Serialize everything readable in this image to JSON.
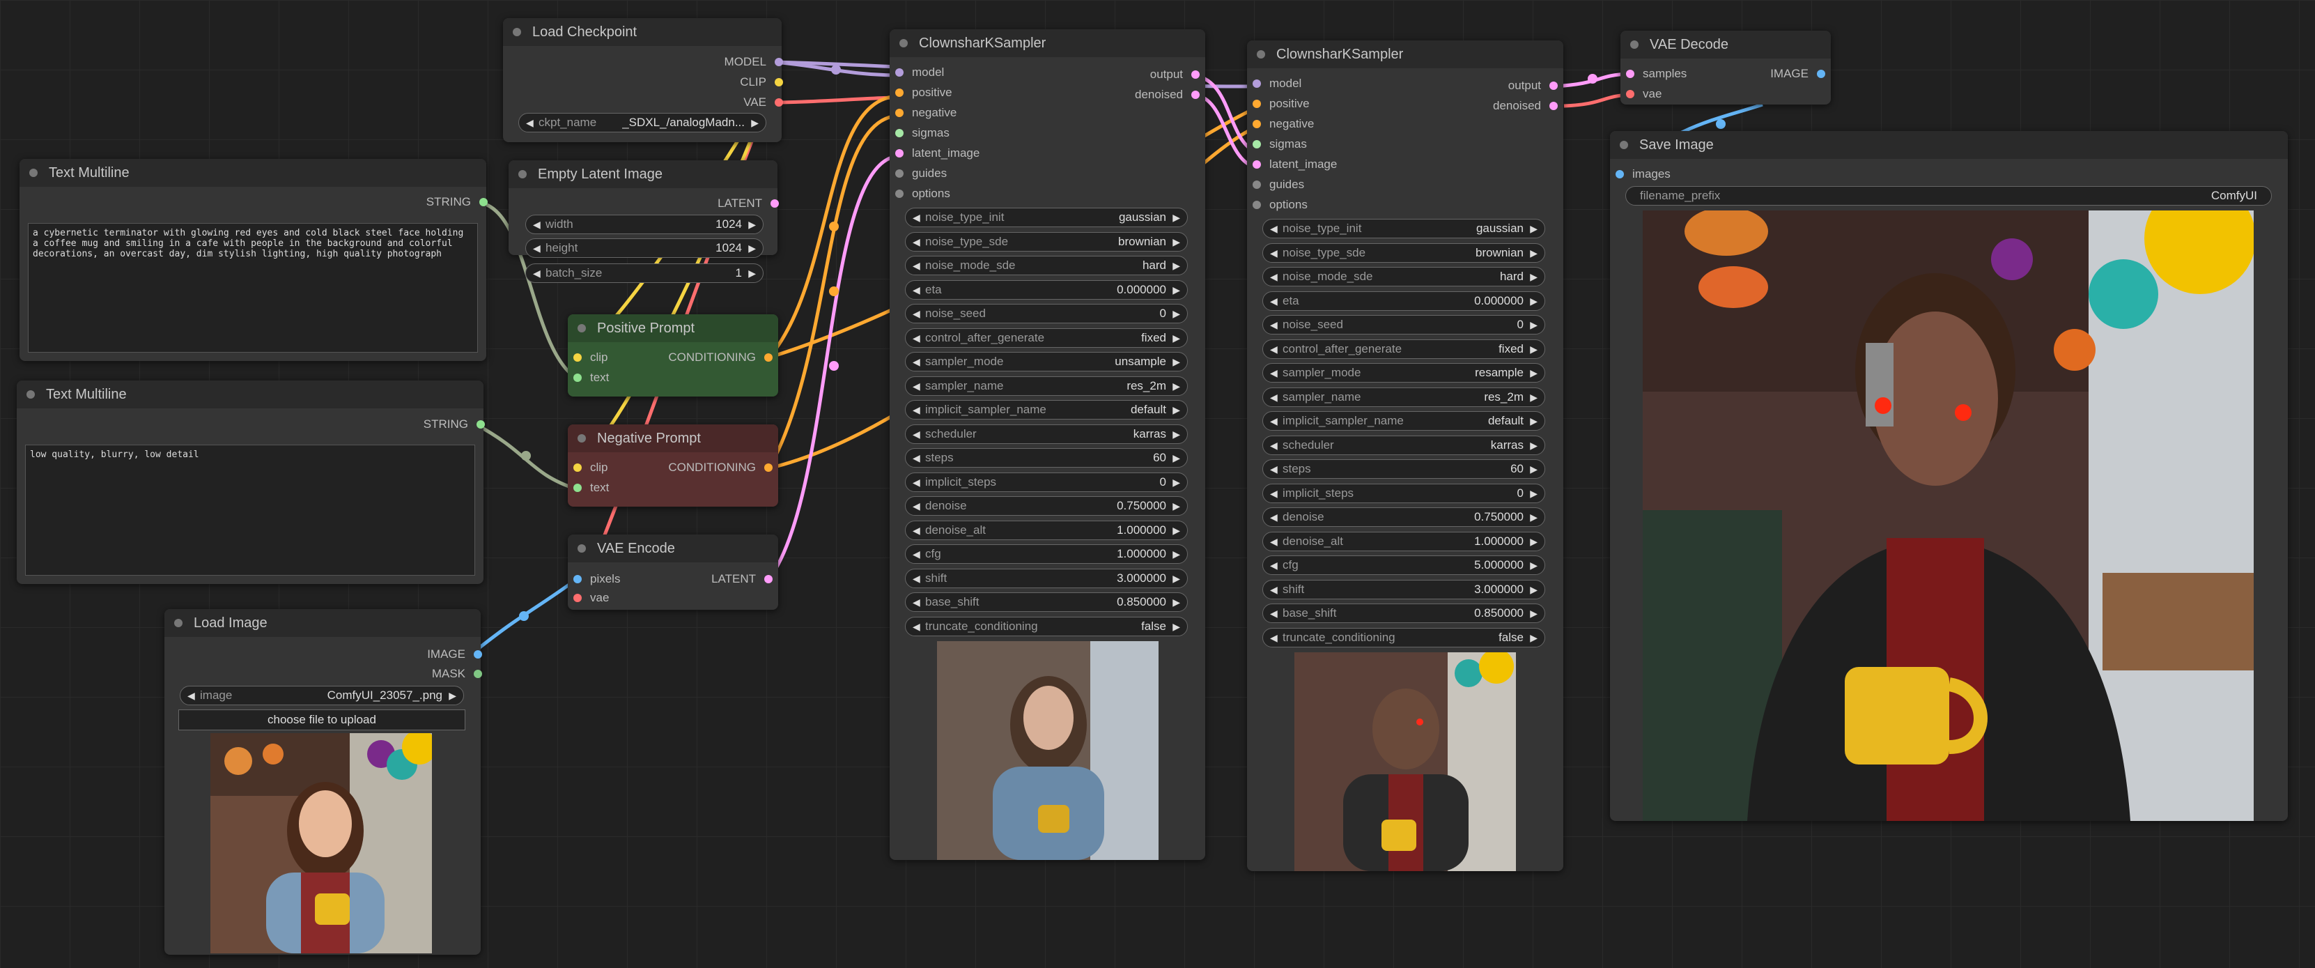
{
  "colors": {
    "model": "#b39ddb",
    "clip": "#f5d442",
    "vae": "#ff6e6e",
    "latent": "#ff9cf9",
    "conditioning": "#ffa931",
    "string": "#8ee08e",
    "image": "#64b5f6"
  },
  "load_checkpoint": {
    "title": "Load Checkpoint",
    "out_model": "MODEL",
    "out_clip": "CLIP",
    "out_vae": "VAE",
    "ckpt_label": "ckpt_name",
    "ckpt_value": "_SDXL_/analogMadn..."
  },
  "text1": {
    "title": "Text Multiline",
    "out": "STRING",
    "text": "a cybernetic terminator with glowing red eyes and cold black steel face holding a coffee mug and smiling in a cafe with people in the background and colorful decorations, an overcast day, dim stylish lighting, high quality photograph"
  },
  "text2": {
    "title": "Text Multiline",
    "out": "STRING",
    "text": "low quality, blurry, low detail"
  },
  "empty_latent": {
    "title": "Empty Latent Image",
    "out": "LATENT",
    "widgets": [
      {
        "label": "width",
        "value": "1024"
      },
      {
        "label": "height",
        "value": "1024"
      },
      {
        "label": "batch_size",
        "value": "1"
      }
    ]
  },
  "pos_prompt": {
    "title": "Positive Prompt",
    "in_clip": "clip",
    "in_text": "text",
    "out": "CONDITIONING"
  },
  "neg_prompt": {
    "title": "Negative Prompt",
    "in_clip": "clip",
    "in_text": "text",
    "out": "CONDITIONING"
  },
  "vae_encode": {
    "title": "VAE Encode",
    "in_pixels": "pixels",
    "in_vae": "vae",
    "out": "LATENT"
  },
  "load_image": {
    "title": "Load Image",
    "out_image": "IMAGE",
    "out_mask": "MASK",
    "image_label": "image",
    "image_value": "ComfyUI_23057_.png",
    "upload": "choose file to upload"
  },
  "sampler1": {
    "title": "ClownsharKSampler",
    "inputs": [
      "model",
      "positive",
      "negative",
      "sigmas",
      "latent_image",
      "guides",
      "options"
    ],
    "out_output": "output",
    "out_denoised": "denoised",
    "widgets": [
      {
        "label": "noise_type_init",
        "value": "gaussian"
      },
      {
        "label": "noise_type_sde",
        "value": "brownian"
      },
      {
        "label": "noise_mode_sde",
        "value": "hard"
      },
      {
        "label": "eta",
        "value": "0.000000"
      },
      {
        "label": "noise_seed",
        "value": "0"
      },
      {
        "label": "control_after_generate",
        "value": "fixed"
      },
      {
        "label": "sampler_mode",
        "value": "unsample"
      },
      {
        "label": "sampler_name",
        "value": "res_2m"
      },
      {
        "label": "implicit_sampler_name",
        "value": "default"
      },
      {
        "label": "scheduler",
        "value": "karras"
      },
      {
        "label": "steps",
        "value": "60"
      },
      {
        "label": "implicit_steps",
        "value": "0"
      },
      {
        "label": "denoise",
        "value": "0.750000"
      },
      {
        "label": "denoise_alt",
        "value": "1.000000"
      },
      {
        "label": "cfg",
        "value": "1.000000"
      },
      {
        "label": "shift",
        "value": "3.000000"
      },
      {
        "label": "base_shift",
        "value": "0.850000"
      },
      {
        "label": "truncate_conditioning",
        "value": "false"
      }
    ]
  },
  "sampler2": {
    "title": "ClownsharKSampler",
    "inputs": [
      "model",
      "positive",
      "negative",
      "sigmas",
      "latent_image",
      "guides",
      "options"
    ],
    "out_output": "output",
    "out_denoised": "denoised",
    "widgets": [
      {
        "label": "noise_type_init",
        "value": "gaussian"
      },
      {
        "label": "noise_type_sde",
        "value": "brownian"
      },
      {
        "label": "noise_mode_sde",
        "value": "hard"
      },
      {
        "label": "eta",
        "value": "0.000000"
      },
      {
        "label": "noise_seed",
        "value": "0"
      },
      {
        "label": "control_after_generate",
        "value": "fixed"
      },
      {
        "label": "sampler_mode",
        "value": "resample"
      },
      {
        "label": "sampler_name",
        "value": "res_2m"
      },
      {
        "label": "implicit_sampler_name",
        "value": "default"
      },
      {
        "label": "scheduler",
        "value": "karras"
      },
      {
        "label": "steps",
        "value": "60"
      },
      {
        "label": "implicit_steps",
        "value": "0"
      },
      {
        "label": "denoise",
        "value": "0.750000"
      },
      {
        "label": "denoise_alt",
        "value": "1.000000"
      },
      {
        "label": "cfg",
        "value": "5.000000"
      },
      {
        "label": "shift",
        "value": "3.000000"
      },
      {
        "label": "base_shift",
        "value": "0.850000"
      },
      {
        "label": "truncate_conditioning",
        "value": "false"
      }
    ]
  },
  "vae_decode": {
    "title": "VAE Decode",
    "in_samples": "samples",
    "in_vae": "vae",
    "out": "IMAGE"
  },
  "save_image": {
    "title": "Save Image",
    "in_images": "images",
    "prefix_label": "filename_prefix",
    "prefix_value": "ComfyUI"
  }
}
